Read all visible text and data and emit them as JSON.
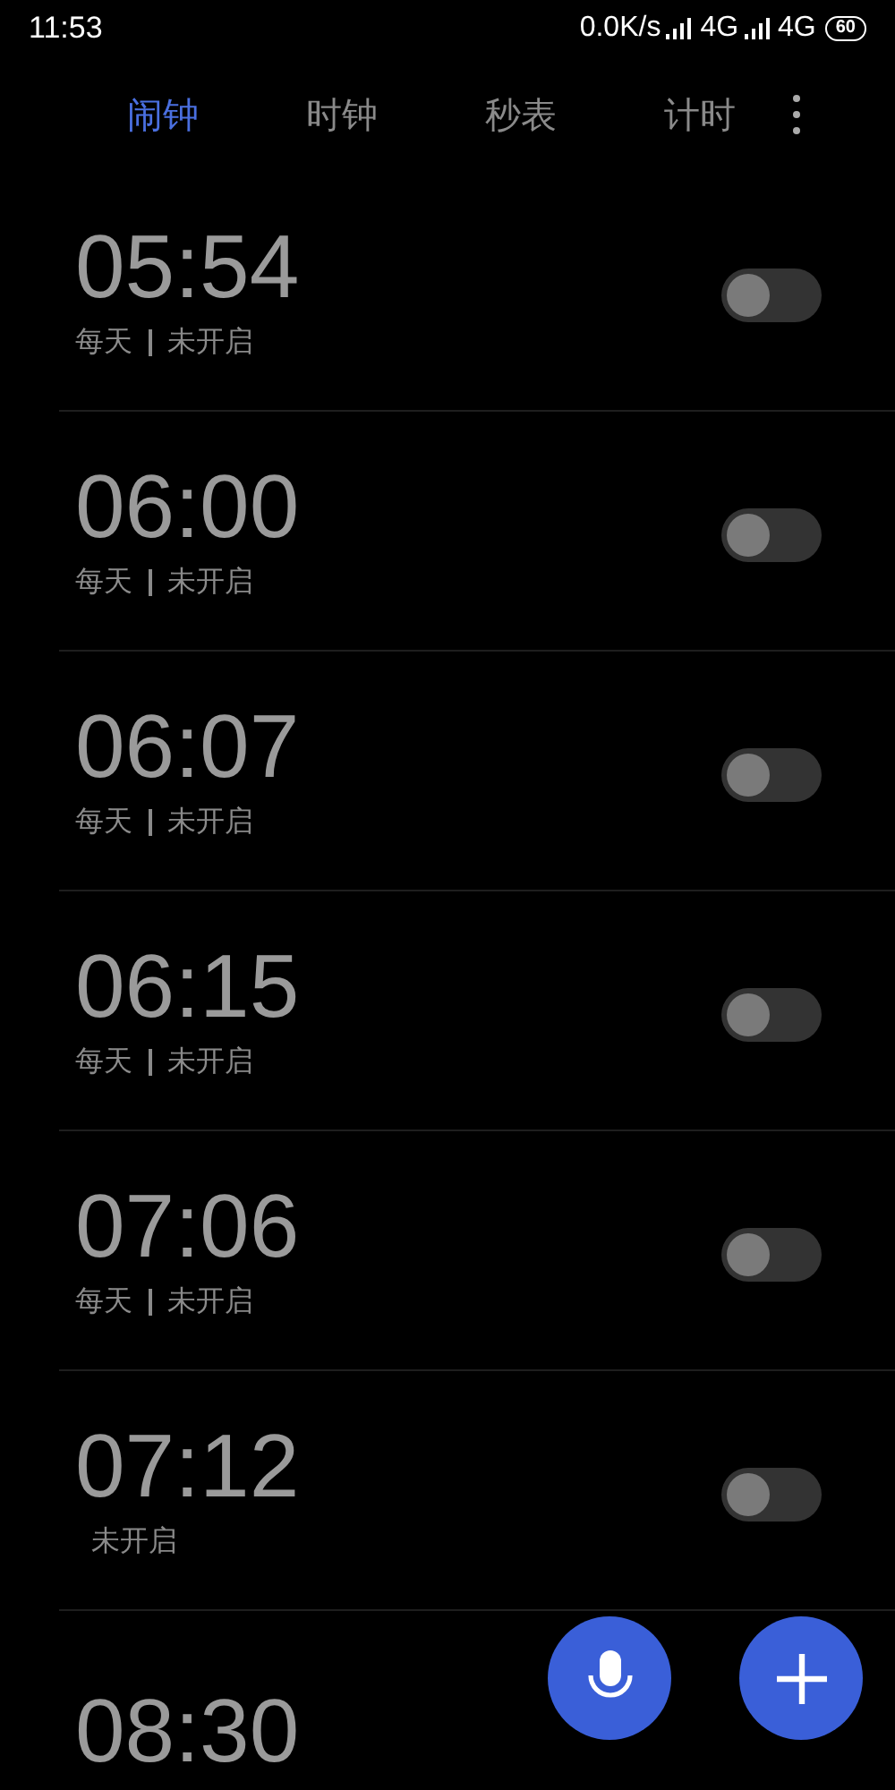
{
  "status_bar": {
    "time": "11:53",
    "speed": "0.0K/s",
    "network_1": "4G",
    "network_2": "4G",
    "battery": "60"
  },
  "tabs": [
    {
      "label": "闹钟",
      "selected": true
    },
    {
      "label": "时钟",
      "selected": false
    },
    {
      "label": "秒表",
      "selected": false
    },
    {
      "label": "计时",
      "selected": false
    }
  ],
  "alarms": [
    {
      "time": "05:54",
      "repeat": "每天",
      "status": "未开启",
      "on": false
    },
    {
      "time": "06:00",
      "repeat": "每天",
      "status": "未开启",
      "on": false
    },
    {
      "time": "06:07",
      "repeat": "每天",
      "status": "未开启",
      "on": false
    },
    {
      "time": "06:15",
      "repeat": "每天",
      "status": "未开启",
      "on": false
    },
    {
      "time": "07:06",
      "repeat": "每天",
      "status": "未开启",
      "on": false
    },
    {
      "time": "07:12",
      "status": "未开启",
      "on": false
    },
    {
      "time": "08:30"
    }
  ]
}
